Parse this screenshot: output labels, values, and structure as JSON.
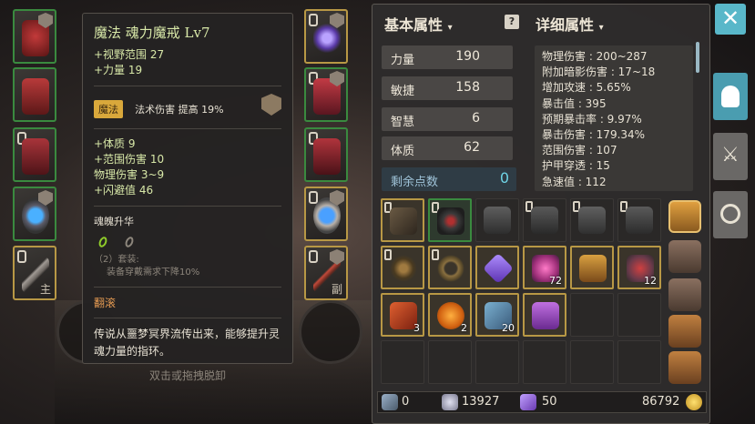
{
  "tooltip": {
    "title": "魔法  魂力魔戒  Lv7",
    "attrs_top": [
      "+视野范围 27",
      "+力量 19"
    ],
    "tag": "魔法",
    "tag_effect": "法术伤害 提高 19%",
    "attrs_mid": [
      "+体质 9",
      "+范围伤害 10",
      "物理伤害 3~9",
      "+闪避值 46"
    ],
    "soul_title": "魂魄升华",
    "set_line1": "（2）套装:",
    "set_line2": "装备穿戴需求下降10%",
    "action": "翻滚",
    "description": "传说从噩梦冥界流传出来，能够提升灵魂力量的指环。"
  },
  "equip_slots": {
    "main_label": "主",
    "sub_label": "副"
  },
  "scene_hint": "双击或拖拽脱卸",
  "basic": {
    "header": "基本属性",
    "stats": [
      {
        "label": "力量",
        "value": "190"
      },
      {
        "label": "敏捷",
        "value": "158"
      },
      {
        "label": "智慧",
        "value": "6"
      },
      {
        "label": "体质",
        "value": "62"
      }
    ],
    "remain_label": "剩余点数",
    "remain_value": "0"
  },
  "detail": {
    "header": "详细属性",
    "lines": [
      "物理伤害 : 200~287",
      "附加暗影伤害 : 17~18",
      "增加攻速 : 5.65%",
      "暴击值 : 395",
      "预期暴击率 : 9.97%",
      "暴击伤害 : 179.34%",
      "范围伤害 : 107",
      "护甲穿透 : 15",
      "急速值 : 112"
    ]
  },
  "inventory": {
    "counts": {
      "r1c4": "72",
      "r1c6": "12",
      "r2c0": "3",
      "r2c1": "2",
      "r2c2": "20"
    }
  },
  "bottom": {
    "keys": "0",
    "souls": "13927",
    "gems": "50",
    "gold": "86792"
  },
  "colors": {
    "accent": "#59b7c9",
    "gold_border": "#b89845",
    "green_border": "#3a8a3f",
    "tag": "#d9a83b"
  }
}
